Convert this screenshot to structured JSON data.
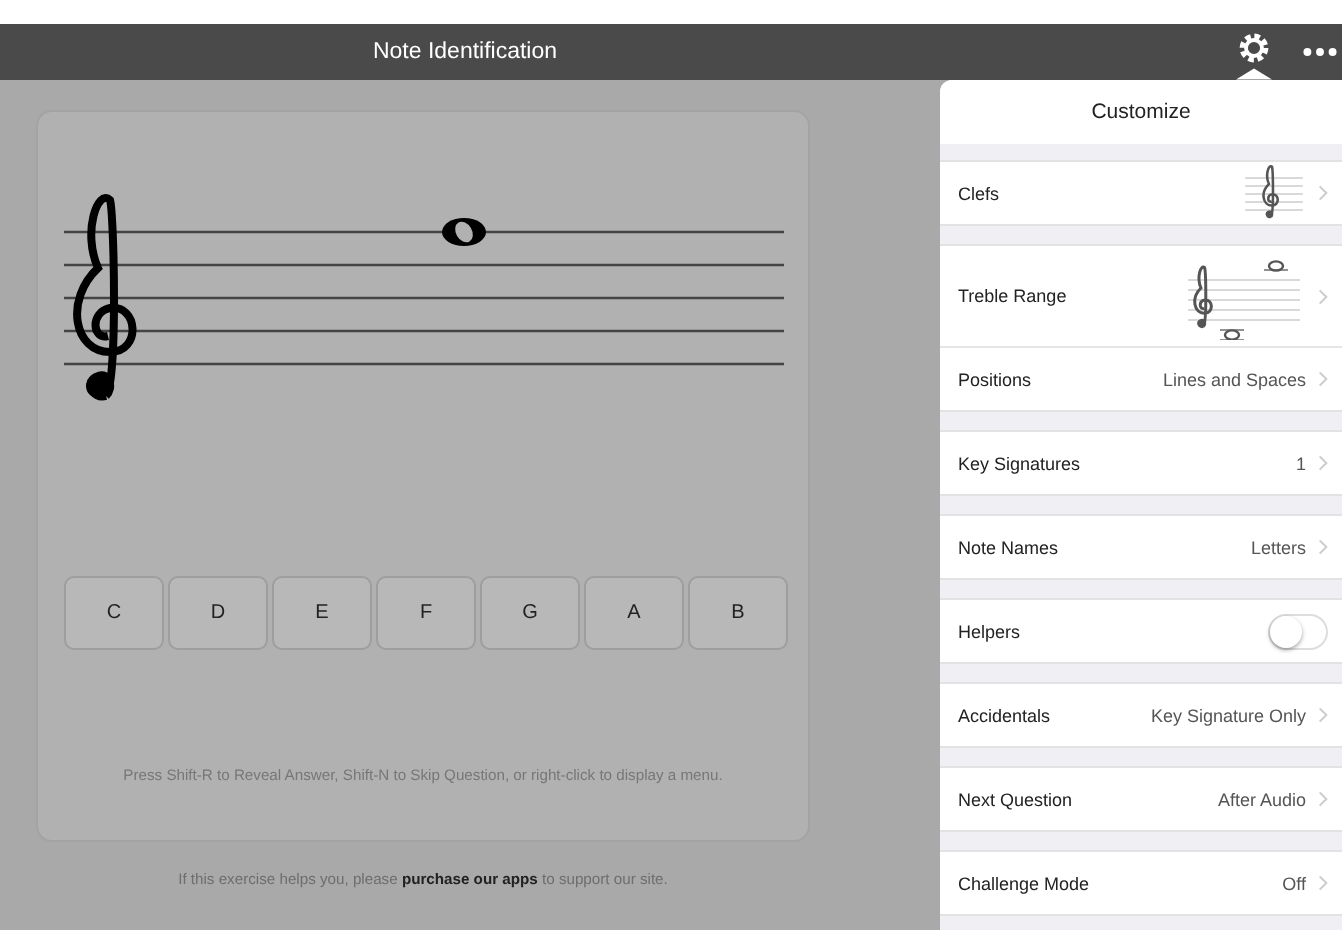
{
  "title_bar": {
    "title": "Note Identification"
  },
  "answer_buttons": [
    "C",
    "D",
    "E",
    "F",
    "G",
    "A",
    "B"
  ],
  "instructions": "Press Shift-R to Reveal Answer, Shift-N to Skip Question, or right-click to display a menu.",
  "footer": {
    "before": "If this exercise helps you, please ",
    "link": "purchase our apps",
    "after": " to support our site."
  },
  "popover": {
    "title": "Customize",
    "sections": [
      {
        "rows": [
          {
            "kind": "clef-preview",
            "label": "Clefs"
          }
        ]
      },
      {
        "rows": [
          {
            "kind": "range-preview",
            "label": "Treble Range"
          },
          {
            "kind": "value",
            "label": "Positions",
            "value": "Lines and Spaces"
          }
        ]
      },
      {
        "rows": [
          {
            "kind": "value",
            "label": "Key Signatures",
            "value": "1"
          }
        ]
      },
      {
        "rows": [
          {
            "kind": "value",
            "label": "Note Names",
            "value": "Letters"
          }
        ]
      },
      {
        "rows": [
          {
            "kind": "toggle",
            "label": "Helpers",
            "on": false
          }
        ]
      },
      {
        "rows": [
          {
            "kind": "value",
            "label": "Accidentals",
            "value": "Key Signature Only"
          }
        ]
      },
      {
        "rows": [
          {
            "kind": "value",
            "label": "Next Question",
            "value": "After Audio"
          }
        ]
      },
      {
        "rows": [
          {
            "kind": "value",
            "label": "Challenge Mode",
            "value": "Off"
          }
        ]
      }
    ]
  }
}
